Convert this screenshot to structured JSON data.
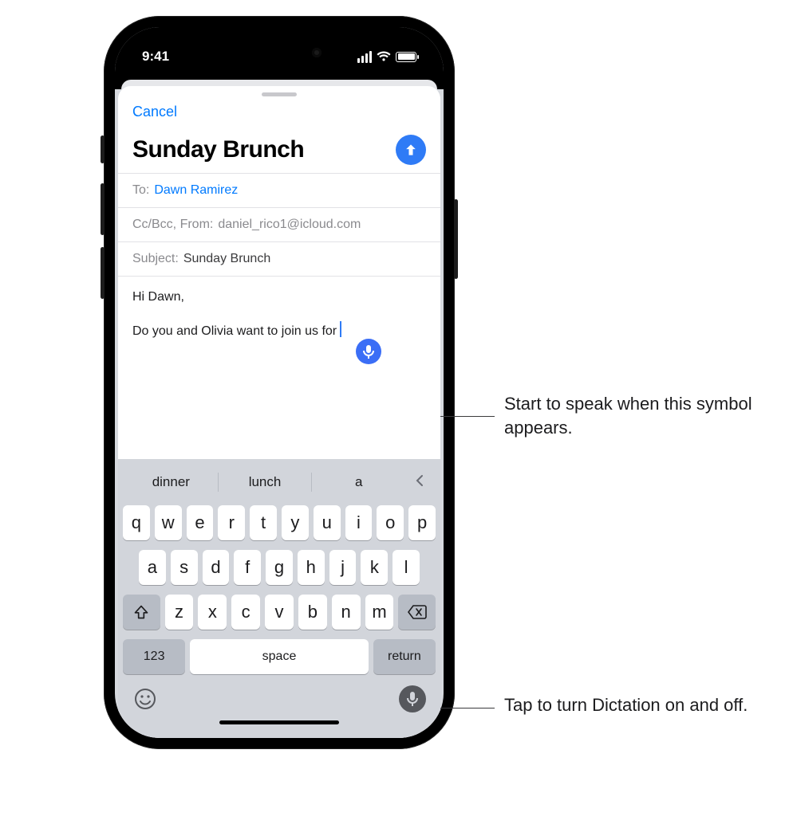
{
  "status": {
    "time": "9:41"
  },
  "nav": {
    "cancel": "Cancel"
  },
  "compose": {
    "title": "Sunday Brunch",
    "to_label": "To:",
    "to_recipient": "Dawn Ramirez",
    "ccbcc_label": "Cc/Bcc, From:",
    "from_address": "daniel_rico1@icloud.com",
    "subject_label": "Subject:",
    "subject_value": "Sunday Brunch",
    "body_line1": "Hi Dawn,",
    "body_line2": "Do you and Olivia want to join us for"
  },
  "keyboard": {
    "suggestions": [
      "dinner",
      "lunch",
      "a"
    ],
    "row1": [
      "q",
      "w",
      "e",
      "r",
      "t",
      "y",
      "u",
      "i",
      "o",
      "p"
    ],
    "row2": [
      "a",
      "s",
      "d",
      "f",
      "g",
      "h",
      "j",
      "k",
      "l"
    ],
    "row3": [
      "z",
      "x",
      "c",
      "v",
      "b",
      "n",
      "m"
    ],
    "numbers": "123",
    "space": "space",
    "return": "return"
  },
  "callouts": {
    "dictation_start": "Start to speak when this symbol appears.",
    "dictation_toggle": "Tap to turn Dictation on and off."
  }
}
